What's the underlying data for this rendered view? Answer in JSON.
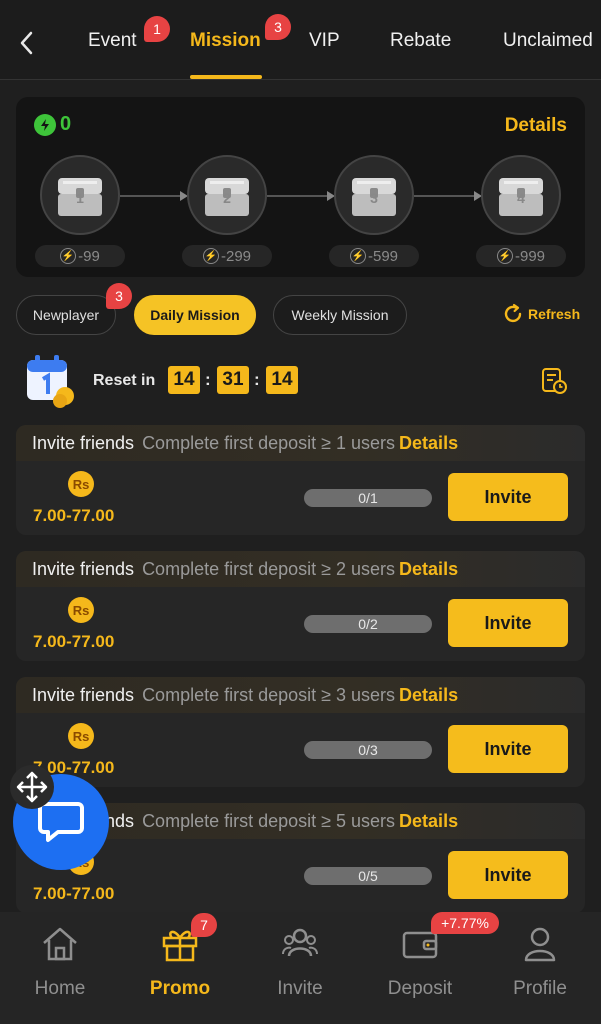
{
  "top_tabs": [
    {
      "label": "Event",
      "badge": "1"
    },
    {
      "label": "Mission",
      "badge": "3"
    },
    {
      "label": "VIP"
    },
    {
      "label": "Rebate"
    },
    {
      "label": "Unclaimed"
    }
  ],
  "chest_panel": {
    "energy_value": "0",
    "details_label": "Details",
    "chests": [
      {
        "number": "1",
        "cost": "-99"
      },
      {
        "number": "2",
        "cost": "-299"
      },
      {
        "number": "3",
        "cost": "-599"
      },
      {
        "number": "4",
        "cost": "-999"
      }
    ]
  },
  "mission_types": [
    {
      "label": "Newplayer",
      "badge": "3"
    },
    {
      "label": "Daily Mission",
      "active": true
    },
    {
      "label": "Weekly Mission"
    }
  ],
  "refresh_label": "Refresh",
  "reset": {
    "label": "Reset in",
    "hours": "14",
    "minutes": "31",
    "seconds": "14"
  },
  "missions": [
    {
      "title": "Invite friends",
      "description": "Complete first deposit ≥ 1 users",
      "details": "Details",
      "currency": "Rs",
      "reward": "7.00-77.00",
      "progress": "0/1",
      "action": "Invite"
    },
    {
      "title": "Invite friends",
      "description": "Complete first deposit ≥ 2 users",
      "details": "Details",
      "currency": "Rs",
      "reward": "7.00-77.00",
      "progress": "0/2",
      "action": "Invite"
    },
    {
      "title": "Invite friends",
      "description": "Complete first deposit ≥ 3 users",
      "details": "Details",
      "currency": "Rs",
      "reward": "7.00-77.00",
      "progress": "0/3",
      "action": "Invite"
    },
    {
      "title": "Invite friends",
      "description": "Complete first deposit ≥ 5 users",
      "details": "Details",
      "currency": "Rs",
      "reward": "7.00-77.00",
      "progress": "0/5",
      "action": "Invite"
    }
  ],
  "bottom_nav": [
    {
      "label": "Home",
      "icon": "home-icon"
    },
    {
      "label": "Promo",
      "icon": "gift-icon",
      "active": true,
      "badge": "7"
    },
    {
      "label": "Invite",
      "icon": "invite-icon"
    },
    {
      "label": "Deposit",
      "icon": "wallet-icon",
      "badge": "+7.77%"
    },
    {
      "label": "Profile",
      "icon": "profile-icon"
    }
  ],
  "colors": {
    "accent": "#f5b81b",
    "background": "#1f1f1f",
    "badge": "#e74343",
    "energy": "#3ec43a",
    "chat_button": "#1d6ff2"
  }
}
